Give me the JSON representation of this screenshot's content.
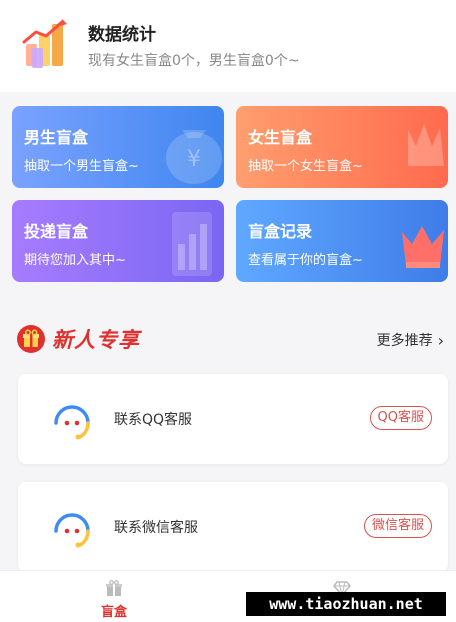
{
  "stats": {
    "title": "数据统计",
    "subtitle": "现有女生盲盒0个，男生盲盒0个~"
  },
  "cards": [
    {
      "id": "boy",
      "title": "男生盲盒",
      "sub": "抽取一个男生盲盒~",
      "icon": "money-bag-icon"
    },
    {
      "id": "girl",
      "title": "女生盲盒",
      "sub": "抽取一个女生盲盒~",
      "icon": "heart-hand-icon"
    },
    {
      "id": "deliver",
      "title": "投递盲盒",
      "sub": "期待您加入其中~",
      "icon": "chart-icon"
    },
    {
      "id": "record",
      "title": "盲盒记录",
      "sub": "查看属于你的盲盒~",
      "icon": "crown-icon"
    }
  ],
  "newbie": {
    "title": "新人专享",
    "more": "更多推荐"
  },
  "services": [
    {
      "label": "联系QQ客服",
      "button": "QQ客服"
    },
    {
      "label": "联系微信客服",
      "button": "微信客服"
    }
  ],
  "tabbar": {
    "box": "盲盒",
    "mine": ""
  },
  "watermark": "www.tiaozhuan.net",
  "colors": {
    "accent": "#e0312f",
    "boy_card": "#3f86ef",
    "girl_card": "#ff6a4e",
    "deliver_card": "#7a66f2",
    "record_card": "#3f7ce8"
  }
}
